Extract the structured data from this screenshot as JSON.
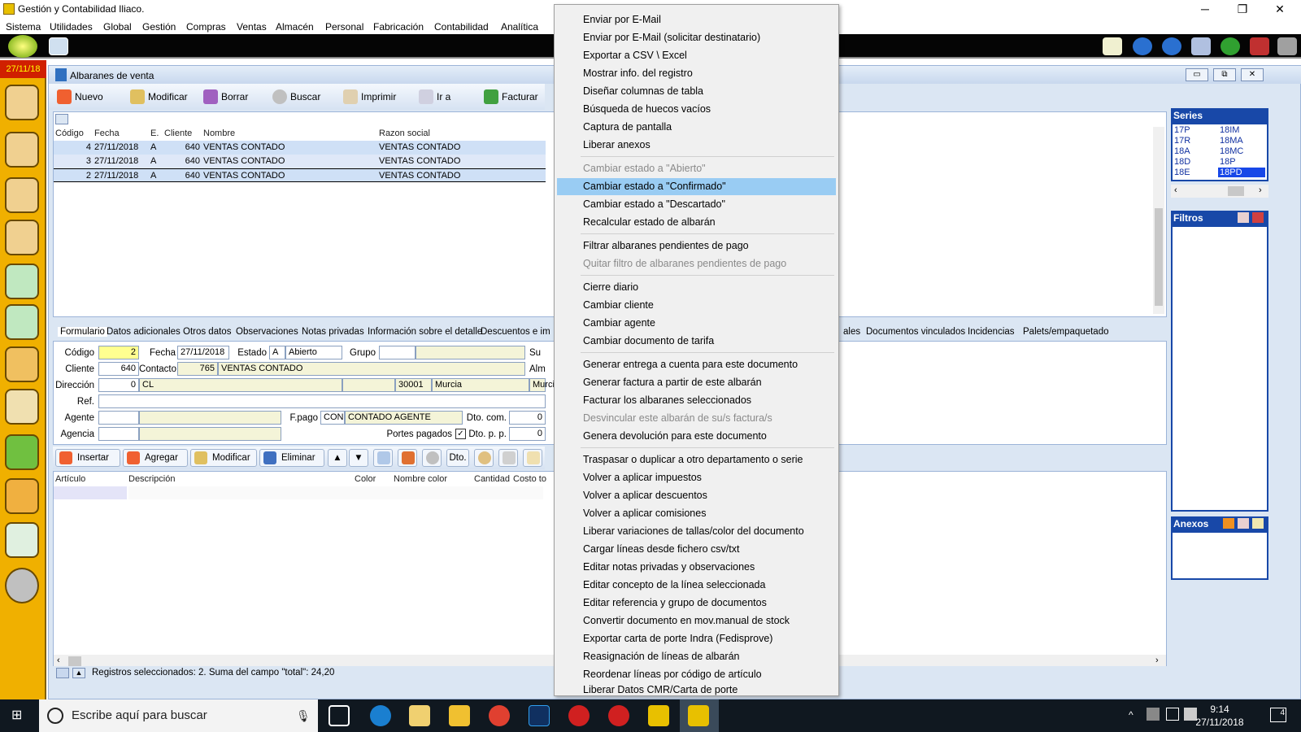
{
  "window": {
    "title": "Gestión y Contabilidad Iliaco."
  },
  "menu": [
    "Sistema",
    "Utilidades",
    "Global",
    "Gestión",
    "Compras",
    "Ventas",
    "Almacén",
    "Personal",
    "Fabricación",
    "Contabilidad",
    "Analítica"
  ],
  "sidebar": {
    "date": "27/11/18"
  },
  "doc": {
    "title": "Albaranes de venta",
    "toolbar": [
      "Nuevo",
      "Modificar",
      "Borrar",
      "Buscar",
      "Imprimir",
      "Ir a",
      "Facturar"
    ],
    "columns": [
      "Código",
      "Fecha",
      "E.",
      "Cliente",
      "Nombre",
      "Razon social"
    ],
    "rows": [
      {
        "codigo": "4",
        "fecha": "27/11/2018",
        "e": "A",
        "cliente": "640",
        "nombre": "VENTAS CONTADO",
        "razon": "VENTAS CONTADO"
      },
      {
        "codigo": "3",
        "fecha": "27/11/2018",
        "e": "A",
        "cliente": "640",
        "nombre": "VENTAS CONTADO",
        "razon": "VENTAS CONTADO"
      },
      {
        "codigo": "2",
        "fecha": "27/11/2018",
        "e": "A",
        "cliente": "640",
        "nombre": "VENTAS CONTADO",
        "razon": "VENTAS CONTADO"
      }
    ],
    "tabs": [
      "Formulario",
      "Datos adicionales",
      "Otros datos",
      "Observaciones",
      "Notas privadas",
      "Información sobre el detalle",
      "Descuentos e im",
      "ales",
      "Documentos vinculados",
      "Incidencias",
      "Palets/empaquetado"
    ],
    "form": {
      "codigo_label": "Código",
      "codigo": "2",
      "fecha_label": "Fecha",
      "fecha": "27/11/2018",
      "estado_label": "Estado",
      "estado_code": "A",
      "estado": "Abierto",
      "grupo_label": "Grupo",
      "su_label": "Su",
      "cliente_label": "Cliente",
      "cliente": "640",
      "contacto_label": "Contacto",
      "contacto_code": "765",
      "contacto": "VENTAS CONTADO",
      "alm_label": "Alm",
      "direccion_label": "Dirección",
      "direccion_code": "0",
      "direccion": "CL",
      "cp": "30001",
      "ciudad": "Murcia",
      "provincia": "Murcia",
      "ref_label": "Ref.",
      "agente_label": "Agente",
      "fpago_label": "F.pago",
      "fpago_code": "CON",
      "fpago": "CONTADO AGENTE",
      "dtocom_label": "Dto. com.",
      "dtocom": "0",
      "agencia_label": "Agencia",
      "portes_label": "Portes pagados",
      "dtopp_label": "Dto. p. p.",
      "dtopp": "0"
    },
    "line_buttons": [
      "Insertar",
      "Agregar",
      "Modificar",
      "Eliminar",
      "Dto."
    ],
    "line_columns": [
      "Artículo",
      "Descripción",
      "Color",
      "Nombre color",
      "Cantidad",
      "Costo to"
    ],
    "status": "Registros seleccionados: 2. Suma del campo \"total\": 24,20"
  },
  "panels": {
    "series_title": "Series",
    "series": [
      [
        "17P",
        "18IM"
      ],
      [
        "17R",
        "18MA"
      ],
      [
        "18A",
        "18MC"
      ],
      [
        "18D",
        "18P"
      ],
      [
        "18E",
        "18PD"
      ]
    ],
    "filtros_title": "Filtros",
    "anexos_title": "Anexos"
  },
  "context_menu": [
    {
      "label": "Enviar por E-Mail",
      "enabled": true
    },
    {
      "label": "Enviar por E-Mail (solicitar destinatario)",
      "enabled": true
    },
    {
      "label": "Exportar a CSV \\ Excel",
      "enabled": true
    },
    {
      "label": "Mostrar info. del registro",
      "enabled": true
    },
    {
      "label": "Diseñar columnas de tabla",
      "enabled": true
    },
    {
      "label": "Búsqueda de huecos vacíos",
      "enabled": true
    },
    {
      "label": "Captura de pantalla",
      "enabled": true
    },
    {
      "label": "Liberar anexos",
      "enabled": true
    },
    {
      "label": "Cambiar estado a \"Abierto\"",
      "enabled": false
    },
    {
      "label": "Cambiar estado a \"Confirmado\"",
      "enabled": true,
      "highlighted": true
    },
    {
      "label": "Cambiar estado a \"Descartado\"",
      "enabled": true
    },
    {
      "label": "Recalcular estado de albarán",
      "enabled": true
    },
    {
      "label": "Filtrar albaranes pendientes de pago",
      "enabled": true
    },
    {
      "label": "Quitar filtro de albaranes pendientes de pago",
      "enabled": false
    },
    {
      "label": "Cierre diario",
      "enabled": true
    },
    {
      "label": "Cambiar cliente",
      "enabled": true
    },
    {
      "label": "Cambiar agente",
      "enabled": true
    },
    {
      "label": "Cambiar documento de tarifa",
      "enabled": true
    },
    {
      "label": "Generar entrega a cuenta para este documento",
      "enabled": true
    },
    {
      "label": "Generar factura a partir de este albarán",
      "enabled": true
    },
    {
      "label": "Facturar los albaranes seleccionados",
      "enabled": true
    },
    {
      "label": "Desvincular este albarán de su/s factura/s",
      "enabled": false
    },
    {
      "label": "Genera devolución para este documento",
      "enabled": true
    },
    {
      "label": "Traspasar  o duplicar a otro departamento o serie",
      "enabled": true
    },
    {
      "label": "Volver a aplicar impuestos",
      "enabled": true
    },
    {
      "label": "Volver a aplicar descuentos",
      "enabled": true
    },
    {
      "label": "Volver a aplicar comisiones",
      "enabled": true
    },
    {
      "label": "Liberar variaciones de tallas/color del documento",
      "enabled": true
    },
    {
      "label": "Cargar líneas desde fichero csv/txt",
      "enabled": true
    },
    {
      "label": "Editar notas privadas y observaciones",
      "enabled": true
    },
    {
      "label": "Editar concepto de la línea seleccionada",
      "enabled": true
    },
    {
      "label": "Editar referencia y grupo de documentos",
      "enabled": true
    },
    {
      "label": "Convertir documento en mov.manual de stock",
      "enabled": true
    },
    {
      "label": "Exportar carta de porte Indra (Fedisprove)",
      "enabled": true
    },
    {
      "label": "Reasignación de líneas de albarán",
      "enabled": true
    },
    {
      "label": "Reordenar líneas por código de artículo",
      "enabled": true
    },
    {
      "label": "Liberar Datos CMR/Carta de porte",
      "enabled": true
    }
  ],
  "taskbar": {
    "search_placeholder": "Escribe aquí para buscar",
    "time": "9:14",
    "date": "27/11/2018",
    "notifications": "4"
  }
}
